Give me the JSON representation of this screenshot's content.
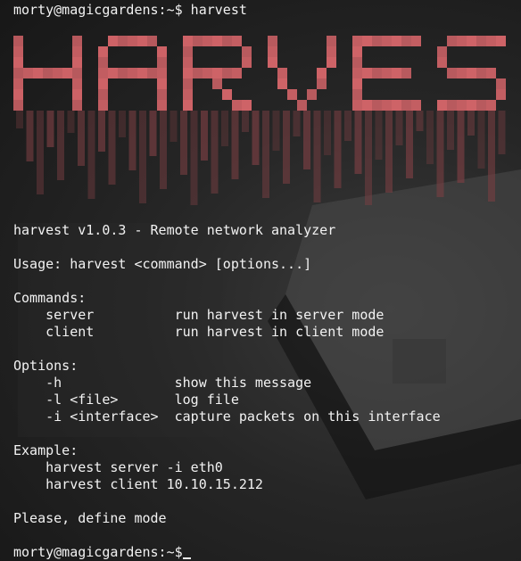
{
  "terminal": {
    "prompt": "morty@magicgardens:~$ harvest",
    "final_prompt": "morty@magicgardens:~$",
    "lines": [
      "harvest v1.0.3 - Remote network analyzer",
      "",
      "Usage: harvest <command> [options...]",
      "",
      "Commands:",
      "    server          run harvest in server mode",
      "    client          run harvest in client mode",
      "",
      "Options:",
      "    -h              show this message",
      "    -l <file>       log file",
      "    -i <interface>  capture packets on this interface",
      "",
      "Example:",
      "    harvest server -i eth0",
      "    harvest client 10.10.15.212",
      "",
      "Please, define mode"
    ],
    "banner_word": "HARVEST",
    "colors": {
      "text": "#f2f2f2",
      "banner": "#d9676b",
      "drip": "#7a3f43"
    }
  }
}
